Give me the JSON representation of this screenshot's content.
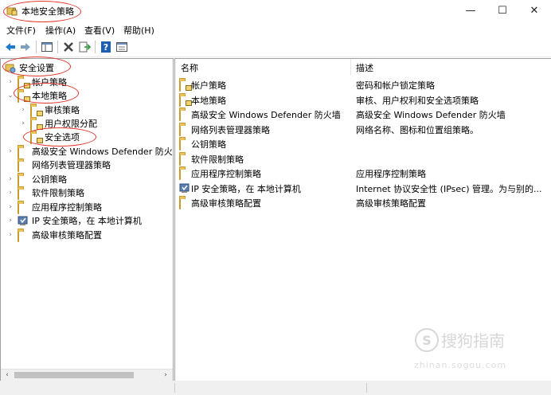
{
  "window": {
    "title": "本地安全策略",
    "minimize_glyph": "—",
    "maximize_glyph": "☐",
    "close_glyph": "✕"
  },
  "menu": {
    "items": [
      "文件(F)",
      "操作(A)",
      "查看(V)",
      "帮助(H)"
    ]
  },
  "toolbar": {
    "buttons": [
      "back-arrow-icon",
      "forward-arrow-icon",
      "show-hide-tree-icon",
      "delete-icon",
      "export-list-icon",
      "help-icon",
      "properties-icon"
    ]
  },
  "tree": {
    "root": "安全设置",
    "items": [
      {
        "label": "帐户策略",
        "expander": "›"
      },
      {
        "label": "本地策略",
        "expander": "⌄"
      },
      {
        "label": "审核策略",
        "expander": "›"
      },
      {
        "label": "用户权限分配",
        "expander": "›"
      },
      {
        "label": "安全选项",
        "expander": ""
      },
      {
        "label": "高级安全 Windows Defender 防火墙",
        "expander": "›"
      },
      {
        "label": "网络列表管理器策略",
        "expander": ""
      },
      {
        "label": "公钥策略",
        "expander": "›"
      },
      {
        "label": "软件限制策略",
        "expander": "›"
      },
      {
        "label": "应用程序控制策略",
        "expander": "›"
      },
      {
        "label": "IP 安全策略，在 本地计算机",
        "expander": "›"
      },
      {
        "label": "高级审核策略配置",
        "expander": "›"
      }
    ]
  },
  "list": {
    "columns": {
      "name": "名称",
      "description": "描述"
    },
    "rows": [
      {
        "name": "帐户策略",
        "description": "密码和帐户锁定策略"
      },
      {
        "name": "本地策略",
        "description": "审核、用户权利和安全选项策略"
      },
      {
        "name": "高级安全 Windows Defender 防火墙",
        "description": "高级安全 Windows Defender 防火墙"
      },
      {
        "name": "网络列表管理器策略",
        "description": "网络名称、图标和位置组策略。"
      },
      {
        "name": "公钥策略",
        "description": ""
      },
      {
        "name": "软件限制策略",
        "description": ""
      },
      {
        "name": "应用程序控制策略",
        "description": "应用程序控制策略"
      },
      {
        "name": "IP 安全策略，在 本地计算机",
        "description": "Internet 协议安全性 (IPsec) 管理。为与别的..."
      },
      {
        "name": "高级审核策略配置",
        "description": "高级审核策略配置"
      }
    ]
  },
  "scroll": {
    "left_arrow": "‹",
    "right_arrow": "›"
  },
  "watermark": {
    "brand": "搜狗指南",
    "url": "zhinan.sogou.com",
    "mark": "S"
  },
  "colors": {
    "annotation": "#e3352b",
    "folder": "#e8c25a"
  }
}
